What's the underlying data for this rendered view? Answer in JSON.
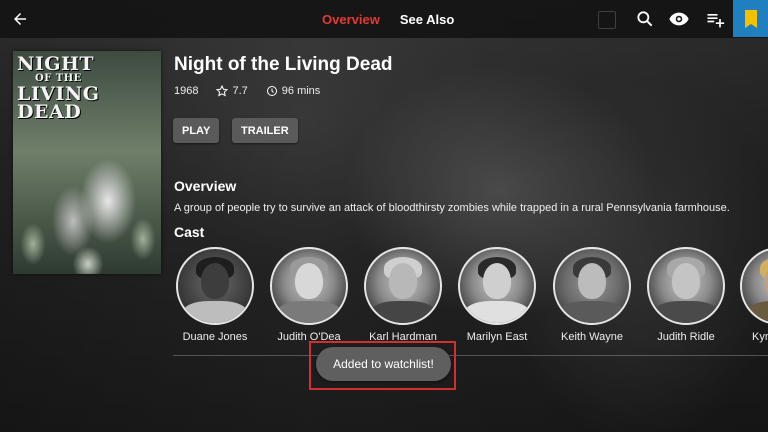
{
  "header": {
    "tabs": [
      {
        "label": "Overview",
        "active": true
      },
      {
        "label": "See Also",
        "active": false
      }
    ],
    "accent_color": "#e53935",
    "bookmark_bg": "#1f7fbf",
    "icons": [
      "arrow-back-icon",
      "search-icon",
      "eye-icon",
      "playlist-add-icon",
      "bookmark-icon"
    ]
  },
  "movie": {
    "poster_title_line1": "NIGHT",
    "poster_title_line2": "OF THE",
    "poster_title_line3": "LIVING",
    "poster_title_line4": "DEAD",
    "title": "Night of the Living Dead",
    "year": "1968",
    "rating": "7.7",
    "runtime": "96 mins"
  },
  "actions": {
    "play_label": "PLAY",
    "trailer_label": "TRAILER"
  },
  "overview": {
    "heading": "Overview",
    "text": "A group of people try to survive an attack of bloodthirsty zombies while trapped in a rural Pennsylvania farmhouse."
  },
  "cast": {
    "heading": "Cast",
    "members": [
      {
        "name": "Duane Jones"
      },
      {
        "name": "Judith O'Dea"
      },
      {
        "name": "Karl Hardman"
      },
      {
        "name": "Marilyn East"
      },
      {
        "name": "Keith Wayne"
      },
      {
        "name": "Judith Ridle"
      },
      {
        "name": "Kyr"
      }
    ]
  },
  "toast": {
    "message": "Added to watchlist!"
  }
}
